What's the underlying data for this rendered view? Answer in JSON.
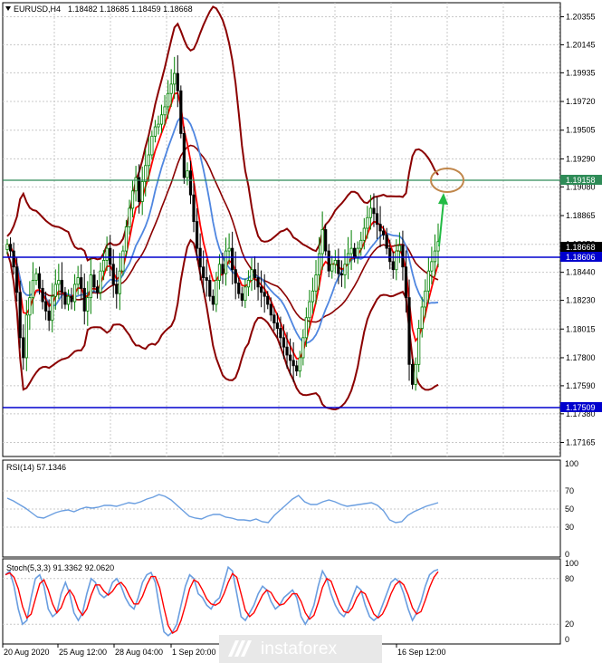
{
  "header": {
    "symbol_tf": "EURUSD,H4",
    "ohlc": "1.18482 1.18685 1.18459 1.18668"
  },
  "price_axis": {
    "ticks": [
      "1.20355",
      "1.20145",
      "1.19935",
      "1.19720",
      "1.19505",
      "1.19290",
      "1.19080",
      "1.18865",
      "1.18650",
      "1.18440",
      "1.18230",
      "1.18015",
      "1.17800",
      "1.17590",
      "1.17380",
      "1.17165"
    ]
  },
  "price_lines": {
    "current_label": "1.18668",
    "green_label": "1.19158",
    "blue_top_label": "1.18606",
    "blue_bottom_label": "1.17509"
  },
  "rsi": {
    "title": "RSI(14) 57.1346",
    "axis": [
      "100",
      "70",
      "50",
      "30",
      "0"
    ]
  },
  "stoch": {
    "title": "Stoch(5,3,3) 91.3362 92.0620",
    "axis": [
      "100",
      "80",
      "20",
      "0"
    ]
  },
  "time_axis": [
    "20 Aug 2020",
    "25 Aug 12:00",
    "28 Aug 04:00",
    "1 Sep 20:00",
    "16 Sep 12:00"
  ],
  "watermark": "instaforex",
  "colors": {
    "bull": "#008000",
    "bear": "#000000",
    "bands": "#8b0000",
    "ma_red": "#ff0000",
    "ma_blue": "#4f86e0",
    "hline_blue": "#0000cd",
    "hline_green": "#2e8b57",
    "target_circle": "#c0864a",
    "arrow": "#22bb44",
    "rsi": "#6a9ee0",
    "stoch_main": "#6a9ee0",
    "stoch_signal": "#ff0000"
  },
  "chart_data": {
    "type": "line",
    "instrument": "EURUSD",
    "timeframe": "H4",
    "y_range": [
      1.1706,
      1.2046
    ],
    "candles_close": [
      1.1865,
      1.186,
      1.1848,
      1.1829,
      1.1795,
      1.178,
      1.1812,
      1.1825,
      1.1838,
      1.1843,
      1.1832,
      1.1822,
      1.1815,
      1.1808,
      1.1826,
      1.1835,
      1.1838,
      1.1829,
      1.182,
      1.1826,
      1.1822,
      1.1835,
      1.184,
      1.1832,
      1.1815,
      1.1825,
      1.1842,
      1.1833,
      1.1829,
      1.1845,
      1.1853,
      1.1862,
      1.185,
      1.1835,
      1.1828,
      1.1845,
      1.186,
      1.1878,
      1.1892,
      1.1905,
      1.1915,
      1.1897,
      1.1912,
      1.1924,
      1.1932,
      1.1946,
      1.1953,
      1.1955,
      1.1962,
      1.1968,
      1.1978,
      1.1985,
      1.1993,
      1.198,
      1.1948,
      1.1915,
      1.192,
      1.1902,
      1.1882,
      1.1862,
      1.1848,
      1.184,
      1.1838,
      1.1826,
      1.182,
      1.1838,
      1.185,
      1.1843,
      1.186,
      1.1862,
      1.1846,
      1.1836,
      1.1828,
      1.1823,
      1.1833,
      1.1838,
      1.1846,
      1.184,
      1.1833,
      1.1829,
      1.1826,
      1.182,
      1.1812,
      1.1806,
      1.1802,
      1.1795,
      1.1788,
      1.1782,
      1.1778,
      1.1774,
      1.177,
      1.178,
      1.1795,
      1.181,
      1.1822,
      1.183,
      1.1842,
      1.1858,
      1.1876,
      1.186,
      1.1845,
      1.185,
      1.1853,
      1.1843,
      1.1842,
      1.185,
      1.1858,
      1.1862,
      1.1855,
      1.1862,
      1.1868,
      1.1877,
      1.1885,
      1.1892,
      1.1888,
      1.188,
      1.1875,
      1.1872,
      1.1862,
      1.1852,
      1.1846,
      1.186,
      1.1864,
      1.1848,
      1.1825,
      1.1775,
      1.176,
      1.1775,
      1.1802,
      1.1818,
      1.183,
      1.1845,
      1.1852,
      1.186,
      1.1867
    ],
    "rsi_values": [
      62,
      59,
      55,
      51,
      46,
      41,
      40,
      43,
      46,
      48,
      49,
      47,
      50,
      52,
      51,
      52,
      54,
      54,
      53,
      55,
      57,
      56,
      58,
      61,
      63,
      66,
      64,
      60,
      54,
      48,
      42,
      40,
      39,
      42,
      44,
      44,
      41,
      40,
      38,
      38,
      37,
      39,
      36,
      35,
      43,
      49,
      55,
      61,
      65,
      58,
      55,
      55,
      58,
      60,
      58,
      55,
      53,
      54,
      55,
      56,
      57,
      54,
      48,
      38,
      35,
      36,
      43,
      47,
      50,
      53,
      55,
      57
    ],
    "stoch_main": [
      85,
      90,
      70,
      40,
      20,
      25,
      55,
      80,
      85,
      70,
      40,
      30,
      35,
      60,
      75,
      60,
      35,
      25,
      35,
      60,
      80,
      75,
      60,
      55,
      60,
      75,
      80,
      70,
      55,
      45,
      40,
      55,
      75,
      85,
      88,
      75,
      40,
      10,
      5,
      10,
      20,
      45,
      70,
      85,
      80,
      60,
      55,
      45,
      40,
      50,
      55,
      75,
      95,
      90,
      60,
      30,
      25,
      35,
      45,
      60,
      70,
      65,
      50,
      40,
      45,
      55,
      60,
      65,
      55,
      30,
      20,
      30,
      45,
      70,
      90,
      80,
      60,
      45,
      35,
      30,
      40,
      55,
      70,
      65,
      45,
      30,
      25,
      30,
      45,
      60,
      75,
      80,
      75,
      60,
      40,
      25,
      35,
      50,
      70,
      85,
      90,
      92
    ],
    "last_rsi": 57.1346,
    "last_stoch_main": 91.3362,
    "last_stoch_signal": 92.062,
    "horizontal_levels": [
      1.19158,
      1.18606,
      1.17509
    ]
  }
}
